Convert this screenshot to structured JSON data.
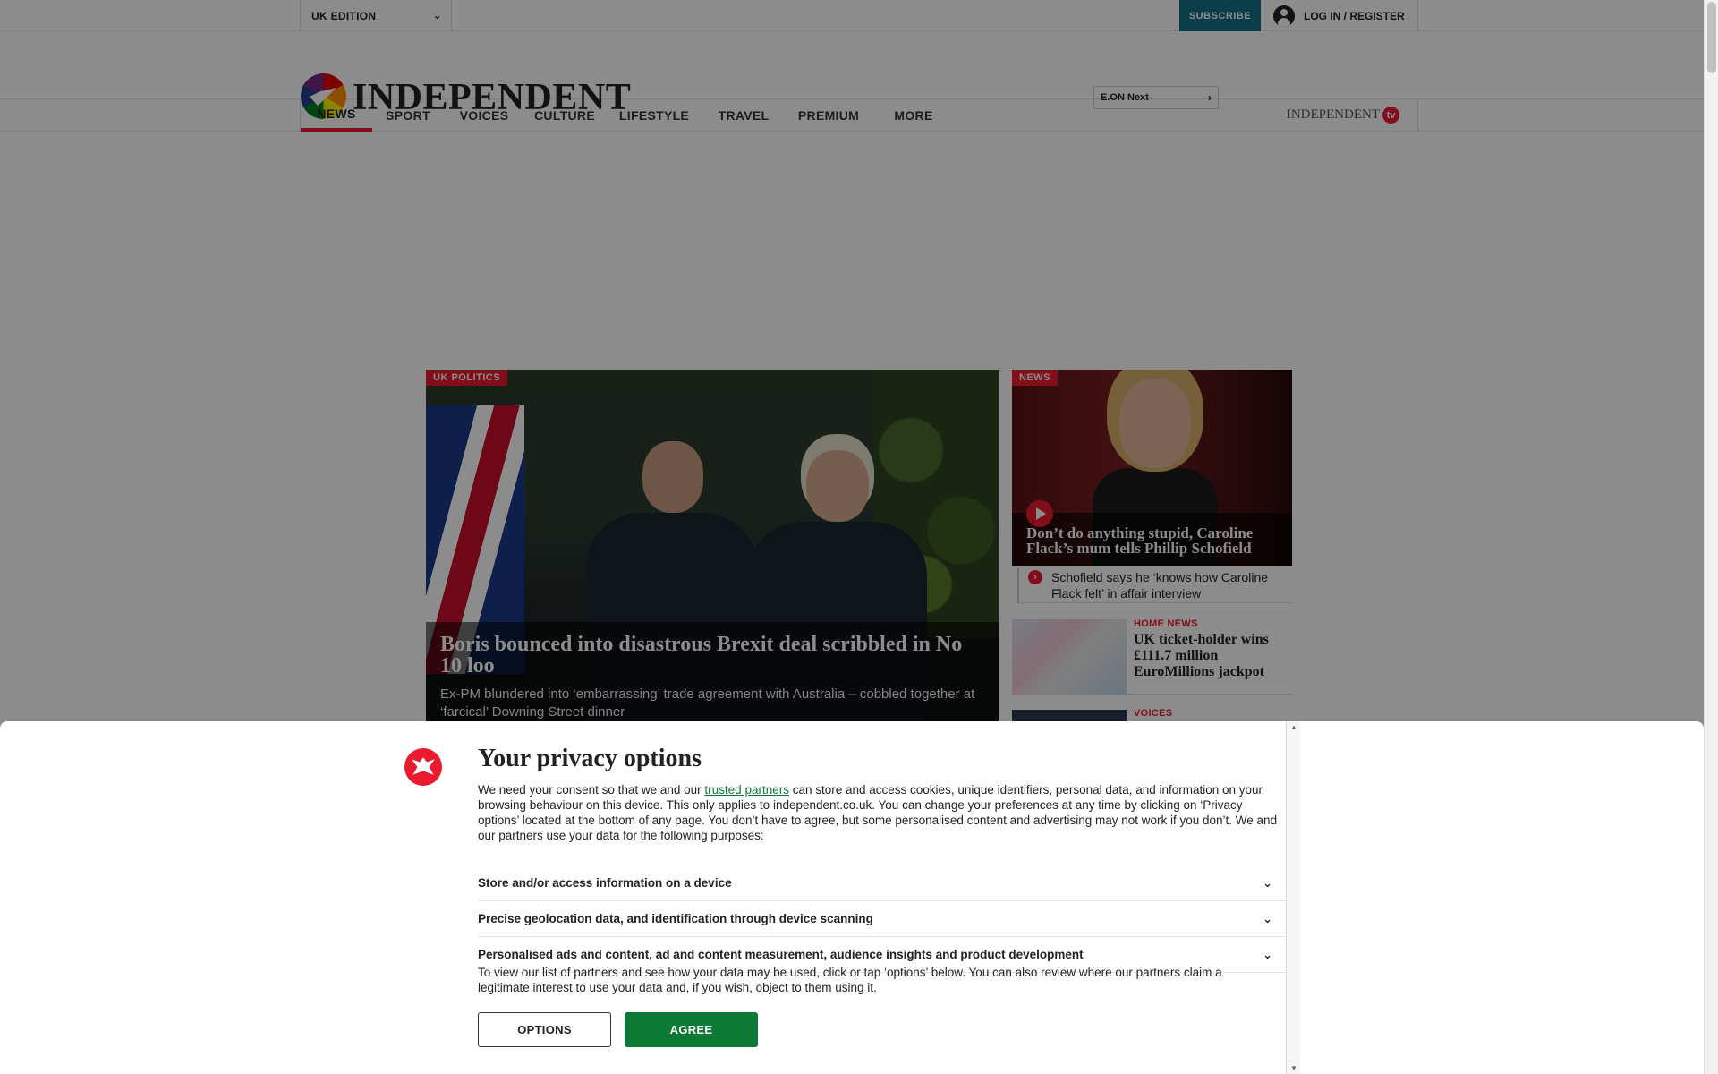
{
  "topbar": {
    "edition": "UK EDITION",
    "subscribe": "SUBSCRIBE",
    "login": "LOG IN / REGISTER"
  },
  "masthead": {
    "logo_text": "INDEPENDENT",
    "sponsor": "E.ON Next"
  },
  "nav": {
    "items": [
      "NEWS",
      "SPORT",
      "VOICES",
      "CULTURE",
      "LIFESTYLE",
      "TRAVEL",
      "PREMIUM",
      "MORE"
    ],
    "active": "NEWS",
    "tv_logo": "INDEPENDENT",
    "tv_badge": "tv"
  },
  "main_story": {
    "tag": "UK POLITICS",
    "headline": "Boris bounced into disastrous Brexit deal scribbled in No 10 loo",
    "standfirst": "Ex-PM blundered into ‘embarrassing’ trade agreement with Australia – cobbled together at ‘farcical’ Downing Street dinner"
  },
  "side_video": {
    "tag": "NEWS",
    "headline": "Don’t do anything stupid, Caroline Flack’s mum tells Phillip Schofield",
    "related": "Schofield says he ‘knows how Caroline Flack felt’ in affair interview"
  },
  "side_items": [
    {
      "section": "HOME NEWS",
      "title": "UK ticket-holder wins £111.7 million EuroMillions jackpot"
    },
    {
      "section": "VOICES",
      "title": ""
    }
  ],
  "privacy": {
    "title": "Your privacy options",
    "intro_before": "We need your consent so that we and our ",
    "intro_link": "trusted partners",
    "intro_after": " can store and access cookies, unique identifiers, personal data, and information on your browsing behaviour on this device. This only applies to independent.co.uk. You can change your preferences at any time by clicking on ‘Privacy options’ located at the bottom of any page. You don’t have to agree, but some personalised content and advertising may not work if you don’t. We and our partners use your data for the following purposes:",
    "purposes": [
      "Store and/or access information on a device",
      "Precise geolocation data, and identification through device scanning",
      "Personalised ads and content, ad and content measurement, audience insights and product development"
    ],
    "note": "To view our list of partners and see how your data may be used, click or tap ‘options’ below. You can also review where our partners claim a legitimate interest to use your data and, if you wish, object to them using it.",
    "options_label": "OPTIONS",
    "agree_label": "AGREE"
  },
  "colors": {
    "brand_red": "#ec1a2e",
    "agree_green": "#0c7a34",
    "subscribe_teal": "#0f6f86"
  }
}
